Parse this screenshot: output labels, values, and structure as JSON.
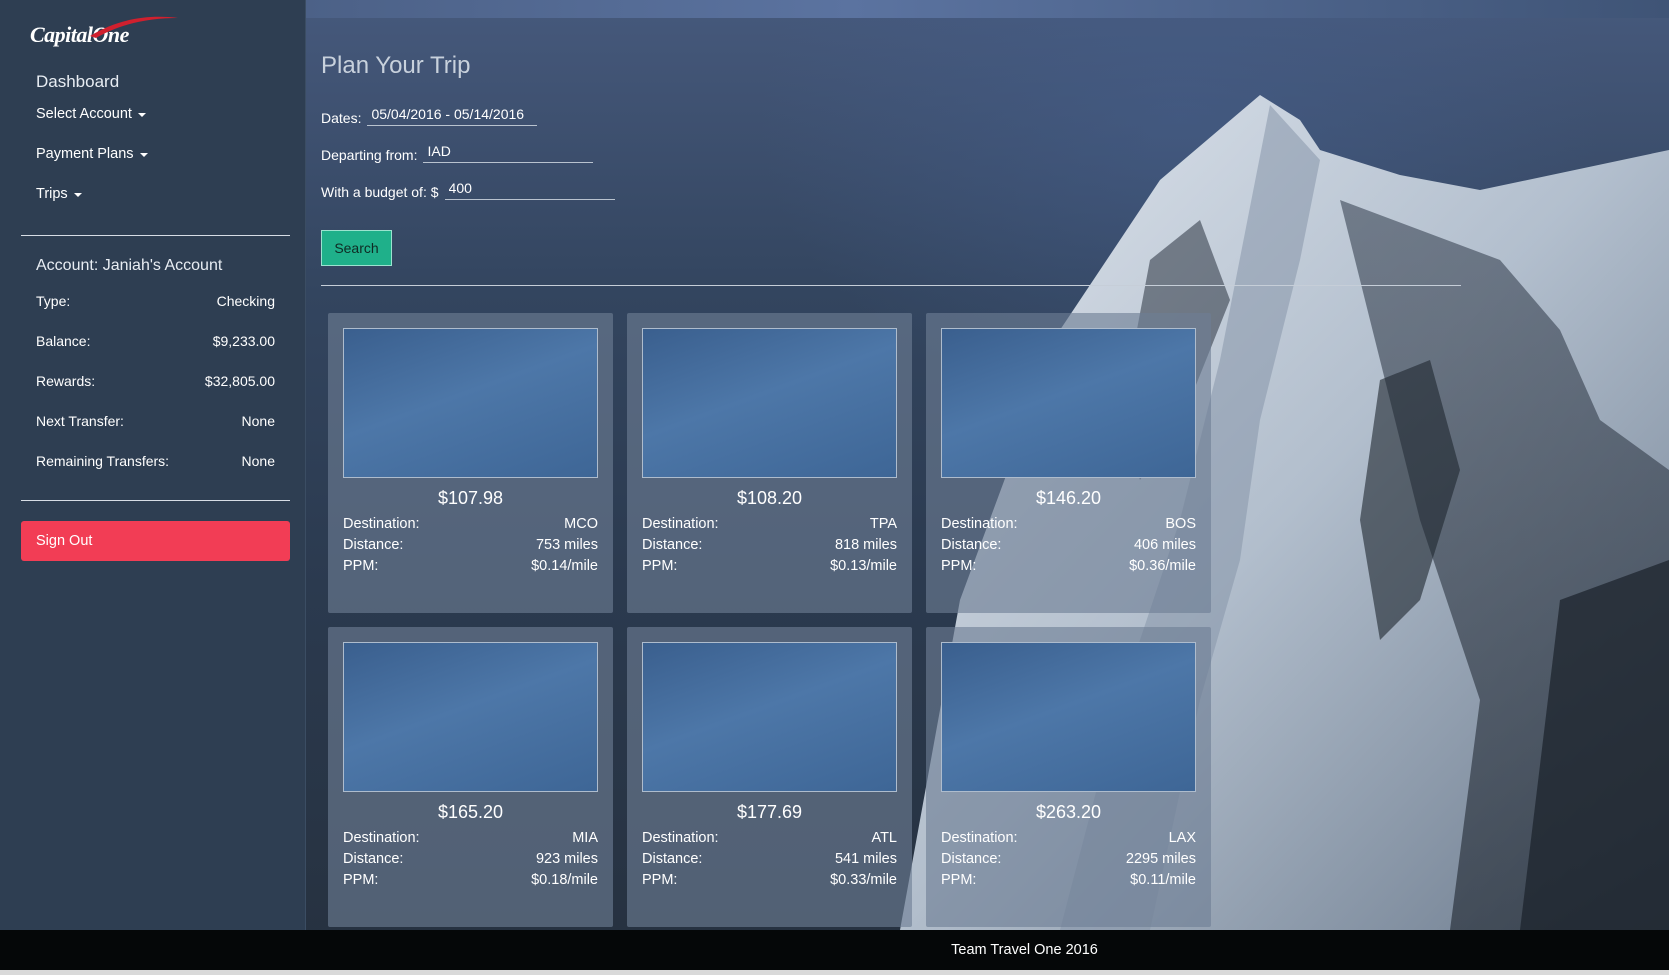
{
  "brand": {
    "logo_text": "Capital",
    "logo_text_2": "One"
  },
  "sidebar": {
    "title": "Dashboard",
    "menu": [
      {
        "label": "Select Account"
      },
      {
        "label": "Payment Plans"
      },
      {
        "label": "Trips"
      }
    ],
    "account": {
      "title": "Account: Janiah's Account",
      "rows": [
        {
          "label": "Type:",
          "value": "Checking"
        },
        {
          "label": "Balance:",
          "value": "$9,233.00"
        },
        {
          "label": "Rewards:",
          "value": "$32,805.00"
        },
        {
          "label": "Next Transfer:",
          "value": "None"
        },
        {
          "label": "Remaining Transfers:",
          "value": "None"
        }
      ]
    },
    "sign_out": "Sign Out"
  },
  "main": {
    "title": "Plan Your Trip",
    "dates_label": "Dates:",
    "dates_value": "05/04/2016 - 05/14/2016",
    "departing_label": "Departing from:",
    "departing_value": "IAD",
    "budget_label": "With a budget of: $",
    "budget_value": "400",
    "search_label": "Search"
  },
  "labels": {
    "destination": "Destination:",
    "distance": "Distance:",
    "ppm": "PPM:"
  },
  "trips": [
    {
      "price": "$107.98",
      "destination": "MCO",
      "distance": "753 miles",
      "ppm": "$0.14/mile"
    },
    {
      "price": "$108.20",
      "destination": "TPA",
      "distance": "818 miles",
      "ppm": "$0.13/mile"
    },
    {
      "price": "$146.20",
      "destination": "BOS",
      "distance": "406 miles",
      "ppm": "$0.36/mile"
    },
    {
      "price": "$165.20",
      "destination": "MIA",
      "distance": "923 miles",
      "ppm": "$0.18/mile"
    },
    {
      "price": "$177.69",
      "destination": "ATL",
      "distance": "541 miles",
      "ppm": "$0.33/mile"
    },
    {
      "price": "$263.20",
      "destination": "LAX",
      "distance": "2295 miles",
      "ppm": "$0.11/mile"
    }
  ],
  "footer": "Team Travel One 2016",
  "colors": {
    "accent": "#1fb08a",
    "danger": "#f23d55",
    "sidebar": "#2e3e52"
  }
}
